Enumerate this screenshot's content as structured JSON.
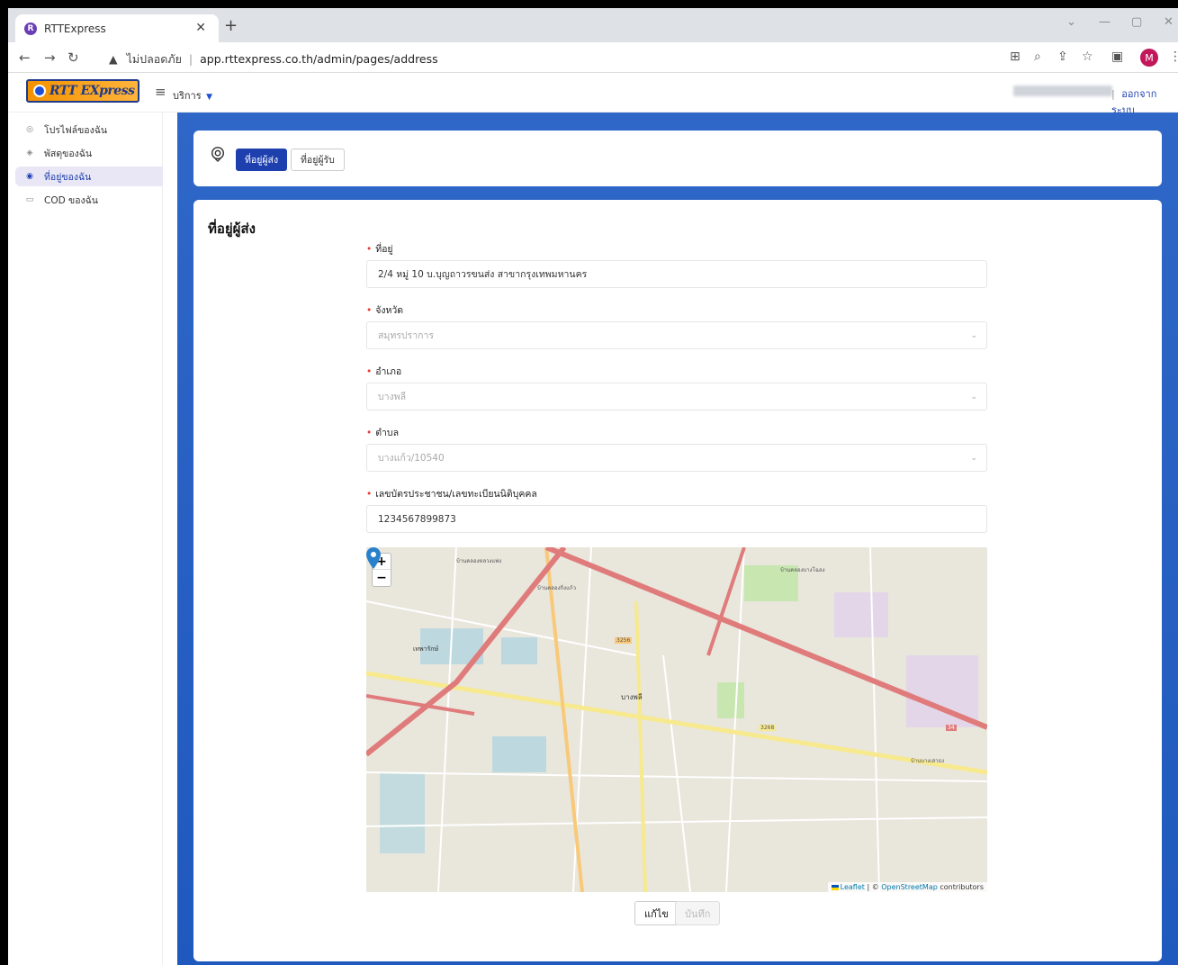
{
  "browser": {
    "tab_title": "RTTExpress",
    "url_warning": "ไม่ปลอดภัย",
    "url": "app.rttexpress.co.th/admin/pages/address",
    "profile_initial": "M"
  },
  "header": {
    "logo_text": "RTT EXpress",
    "services_label": "บริการ",
    "logout_label": "ออกจากระบบ"
  },
  "sidebar": {
    "items": [
      {
        "label": "โปรไฟล์ของฉัน",
        "icon": "user-circle-icon"
      },
      {
        "label": "พัสดุของฉัน",
        "icon": "box-icon"
      },
      {
        "label": "ที่อยู่ของฉัน",
        "icon": "pin-icon",
        "active": true
      },
      {
        "label": "COD ของฉัน",
        "icon": "card-icon"
      }
    ]
  },
  "tabs": {
    "sender": "ที่อยู่ผู้ส่ง",
    "receiver": "ที่อยู่ผู้รับ"
  },
  "form": {
    "title": "ที่อยู่ผู้ส่ง",
    "address_label": "ที่อยู่",
    "address_value": "2/4 หมู่ 10 บ.บุญถาวรขนส่ง สาขากรุงเทพมหานคร",
    "province_label": "จังหวัด",
    "province_value": "สมุทรปราการ",
    "district_label": "อำเภอ",
    "district_value": "บางพลี",
    "subdistrict_label": "ตำบล",
    "subdistrict_value": "บางแก้ว/10540",
    "id_label": "เลขบัตรประชาชน/เลขทะเบียนนิติบุคคล",
    "id_value": "1234567899873"
  },
  "map": {
    "zoom_in": "+",
    "zoom_out": "−",
    "attribution_leaflet": "Leaflet",
    "attribution_sep": " | © ",
    "attribution_osm": "OpenStreetMap",
    "attribution_tail": " contributors",
    "labels": [
      "บางพลี",
      "เทพารักษ์",
      "บ้านคลองบางโฉลง",
      "บ้านบางเสาธง",
      "บ้านคลองหลวงแพ่ง",
      "บ้านคลองกิ่งแก้ว",
      "3256",
      "3268",
      "34"
    ]
  },
  "actions": {
    "edit": "แก้ไข",
    "save": "บันทึก"
  },
  "colors": {
    "primary": "#1e40af",
    "main_bg": "#2e67c7",
    "required": "#e53935",
    "logo_orange": "#f39200"
  }
}
